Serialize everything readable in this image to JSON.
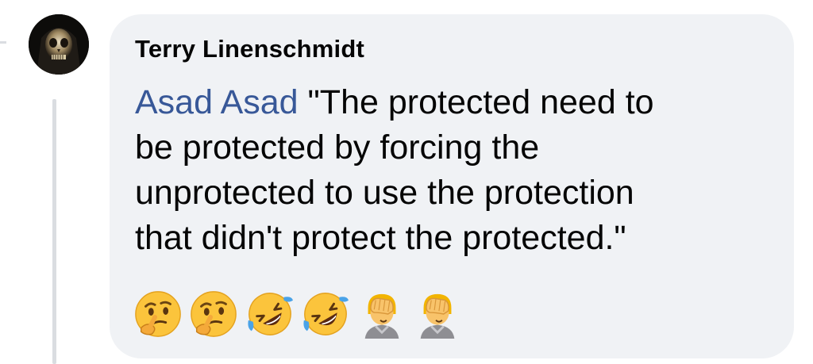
{
  "comment": {
    "author": "Terry Linenschmidt",
    "mention": "Asad Asad",
    "lines": [
      "\"The protected need to",
      "be protected by forcing the",
      "unprotected to use the protection",
      "that didn't protect the protected.\""
    ],
    "emojis": [
      "thinking-face-icon",
      "thinking-face-icon",
      "rolling-on-floor-laughing-icon",
      "rolling-on-floor-laughing-icon",
      "facepalm-icon",
      "facepalm-icon"
    ]
  },
  "colors": {
    "bubble": "#f0f2f5",
    "mention": "#385898",
    "text": "#050505",
    "thread_line": "#dadde1"
  }
}
